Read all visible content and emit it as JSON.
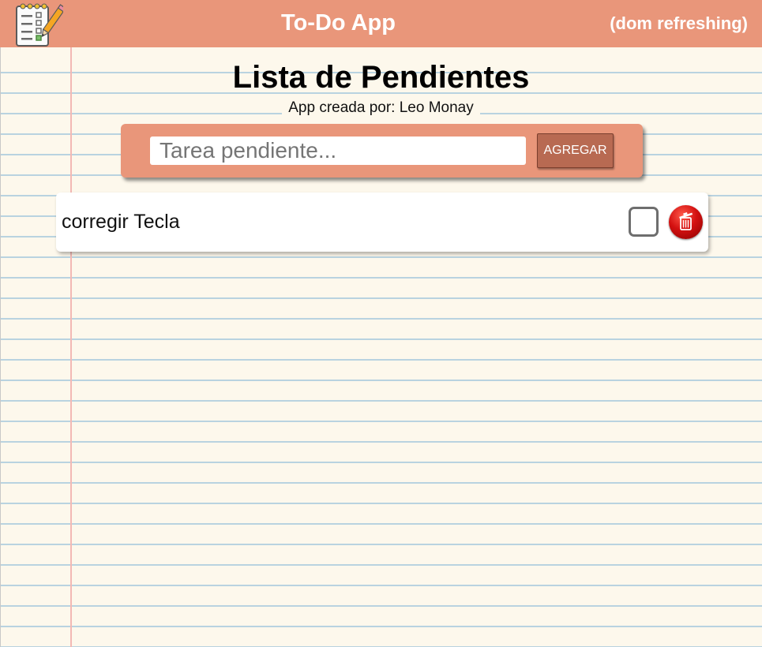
{
  "header": {
    "title": "To-Do App",
    "note": "(dom refreshing)",
    "logo_icon": "notepad-checklist-icon",
    "background_color": "#e9967a"
  },
  "main": {
    "title": "Lista de Pendientes",
    "credit": "App creada por: Leo Monay"
  },
  "add_form": {
    "input_value": "",
    "input_placeholder": "Tarea pendiente...",
    "button_label": "AGREGAR"
  },
  "tasks": [
    {
      "text": "corregir Tecla",
      "completed": false,
      "checkbox_icon": "checkbox-empty-icon",
      "delete_icon": "trash-icon"
    }
  ],
  "colors": {
    "accent": "#e9967a",
    "button": "#b86a52",
    "delete": "#d41111",
    "paper": "#fdf8ec",
    "ruled_line": "#b9d3e0",
    "margin_line": "#f3b9b5"
  }
}
